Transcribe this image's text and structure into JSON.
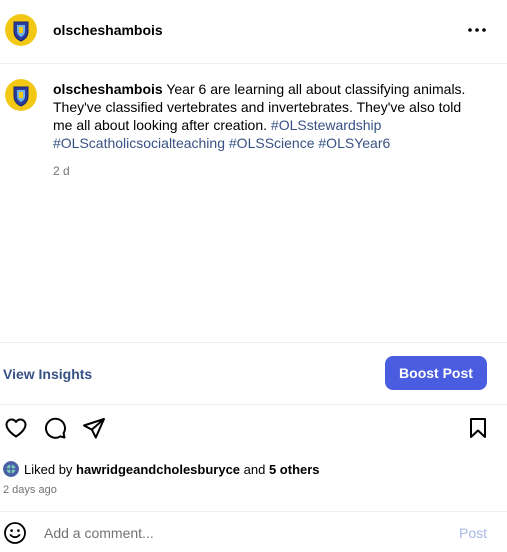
{
  "post": {
    "username": "olscheshambois",
    "more_icon": "more-horizontal-icon",
    "caption": {
      "username": "olscheshambois",
      "text": " Year 6 are learning all about classifying animals. They've classified vertebrates and invertebrates. They've also told me all about looking after creation. ",
      "hashtags": [
        "#OLSstewardship",
        "#OLScatholicsocialteaching",
        "#OLSScience",
        "#OLSYear6"
      ]
    },
    "age": "2 d"
  },
  "insights": {
    "view_label": "View Insights",
    "boost_label": "Boost Post"
  },
  "actions": {
    "icons": [
      "heart-icon",
      "comment-icon",
      "share-icon",
      "bookmark-icon"
    ]
  },
  "likes": {
    "prefix": "Liked by ",
    "user": "hawridgeandcholesburyce",
    "middle": " and ",
    "others": "5 others"
  },
  "date": "2 days ago",
  "comment": {
    "placeholder": "Add a comment...",
    "post_label": "Post"
  },
  "colors": {
    "link": "#385185",
    "boost_button": "#4a5de0",
    "post_disabled": "#a8b8e8",
    "muted": "#737373"
  }
}
